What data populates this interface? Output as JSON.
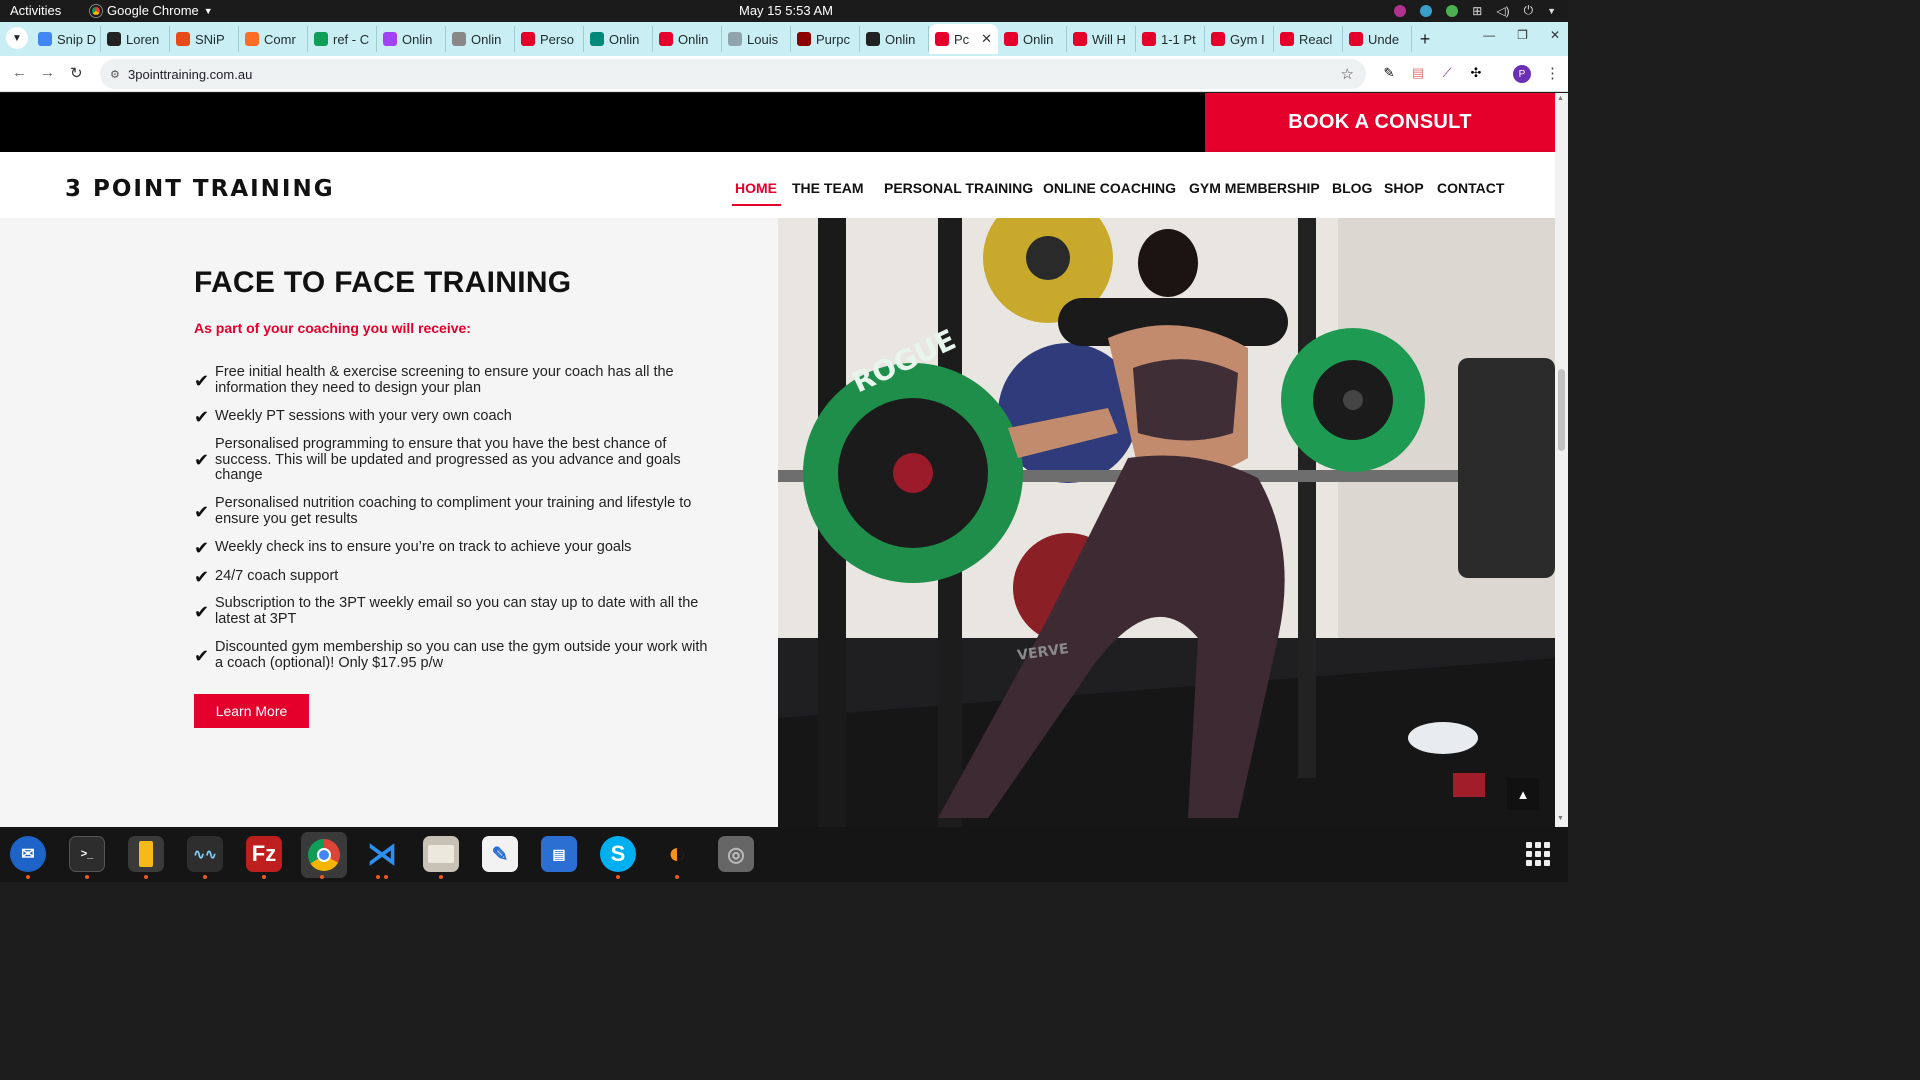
{
  "system": {
    "activities": "Activities",
    "app_name": "Google Chrome",
    "clock": "May 15  5:53 AM"
  },
  "tabs": [
    {
      "label": "Snip D",
      "color": "#4285f4"
    },
    {
      "label": "Loren",
      "color": "#222222"
    },
    {
      "label": "SNiP",
      "color": "#e64a19"
    },
    {
      "label": "Comr",
      "color": "#fc6d26"
    },
    {
      "label": "ref - C",
      "color": "#0f9d58"
    },
    {
      "label": "Onlin",
      "color": "#a142f4"
    },
    {
      "label": "Onlin",
      "color": "#888888"
    },
    {
      "label": "Perso",
      "color": "#e4002b"
    },
    {
      "label": "Onlin",
      "color": "#00897b"
    },
    {
      "label": "Onlin",
      "color": "#e4002b"
    },
    {
      "label": "Louis",
      "color": "#90a4ae"
    },
    {
      "label": "Purpc",
      "color": "#8b0000"
    },
    {
      "label": "Onlin",
      "color": "#222222"
    },
    {
      "label": "Pc",
      "color": "#e4002b",
      "active": true
    },
    {
      "label": "Onlin",
      "color": "#e4002b"
    },
    {
      "label": "Will H",
      "color": "#e4002b"
    },
    {
      "label": "1-1 Pt",
      "color": "#e4002b"
    },
    {
      "label": "Gym I",
      "color": "#e4002b"
    },
    {
      "label": "Reacl",
      "color": "#e4002b"
    },
    {
      "label": "Unde",
      "color": "#e4002b"
    }
  ],
  "omnibox": {
    "url": "3pointtraining.com.au"
  },
  "site": {
    "book_consult": "BOOK A CONSULT",
    "logo": "3 POINT TRAINING",
    "nav": {
      "home": "HOME",
      "team": "THE TEAM",
      "personal_training": "PERSONAL TRAINING",
      "online_coaching": "ONLINE COACHING",
      "gym_membership": "GYM MEMBERSHIP",
      "blog": "BLOG",
      "shop": "SHOP",
      "contact": "CONTACT"
    },
    "section_title": "FACE TO FACE TRAINING",
    "subtitle": "As part of your coaching you will receive:",
    "benefits": [
      "Free initial health & exercise screening to ensure your coach has all the information they need to design your plan",
      "Weekly PT sessions with your very own coach",
      "Personalised programming to ensure that you have the best chance of success. This will be updated and progressed as you advance and goals change",
      "Personalised nutrition coaching to compliment your training and lifestyle to ensure you get results",
      "Weekly check ins to ensure you’re on track to achieve your goals",
      "24/7 coach support",
      "Subscription to the 3PT weekly email so you can stay up to date with all the latest at 3PT",
      "Discounted gym membership so you can use the gym outside your work with a coach (optional)! Only $17.95 p/w"
    ],
    "learn_more": "Learn More",
    "photo_text": {
      "plate_brand": "ROGUE",
      "rack_brand": "VERVE"
    }
  },
  "colors": {
    "brand_red": "#e4002b",
    "tab_strip": "#c9eff5"
  }
}
